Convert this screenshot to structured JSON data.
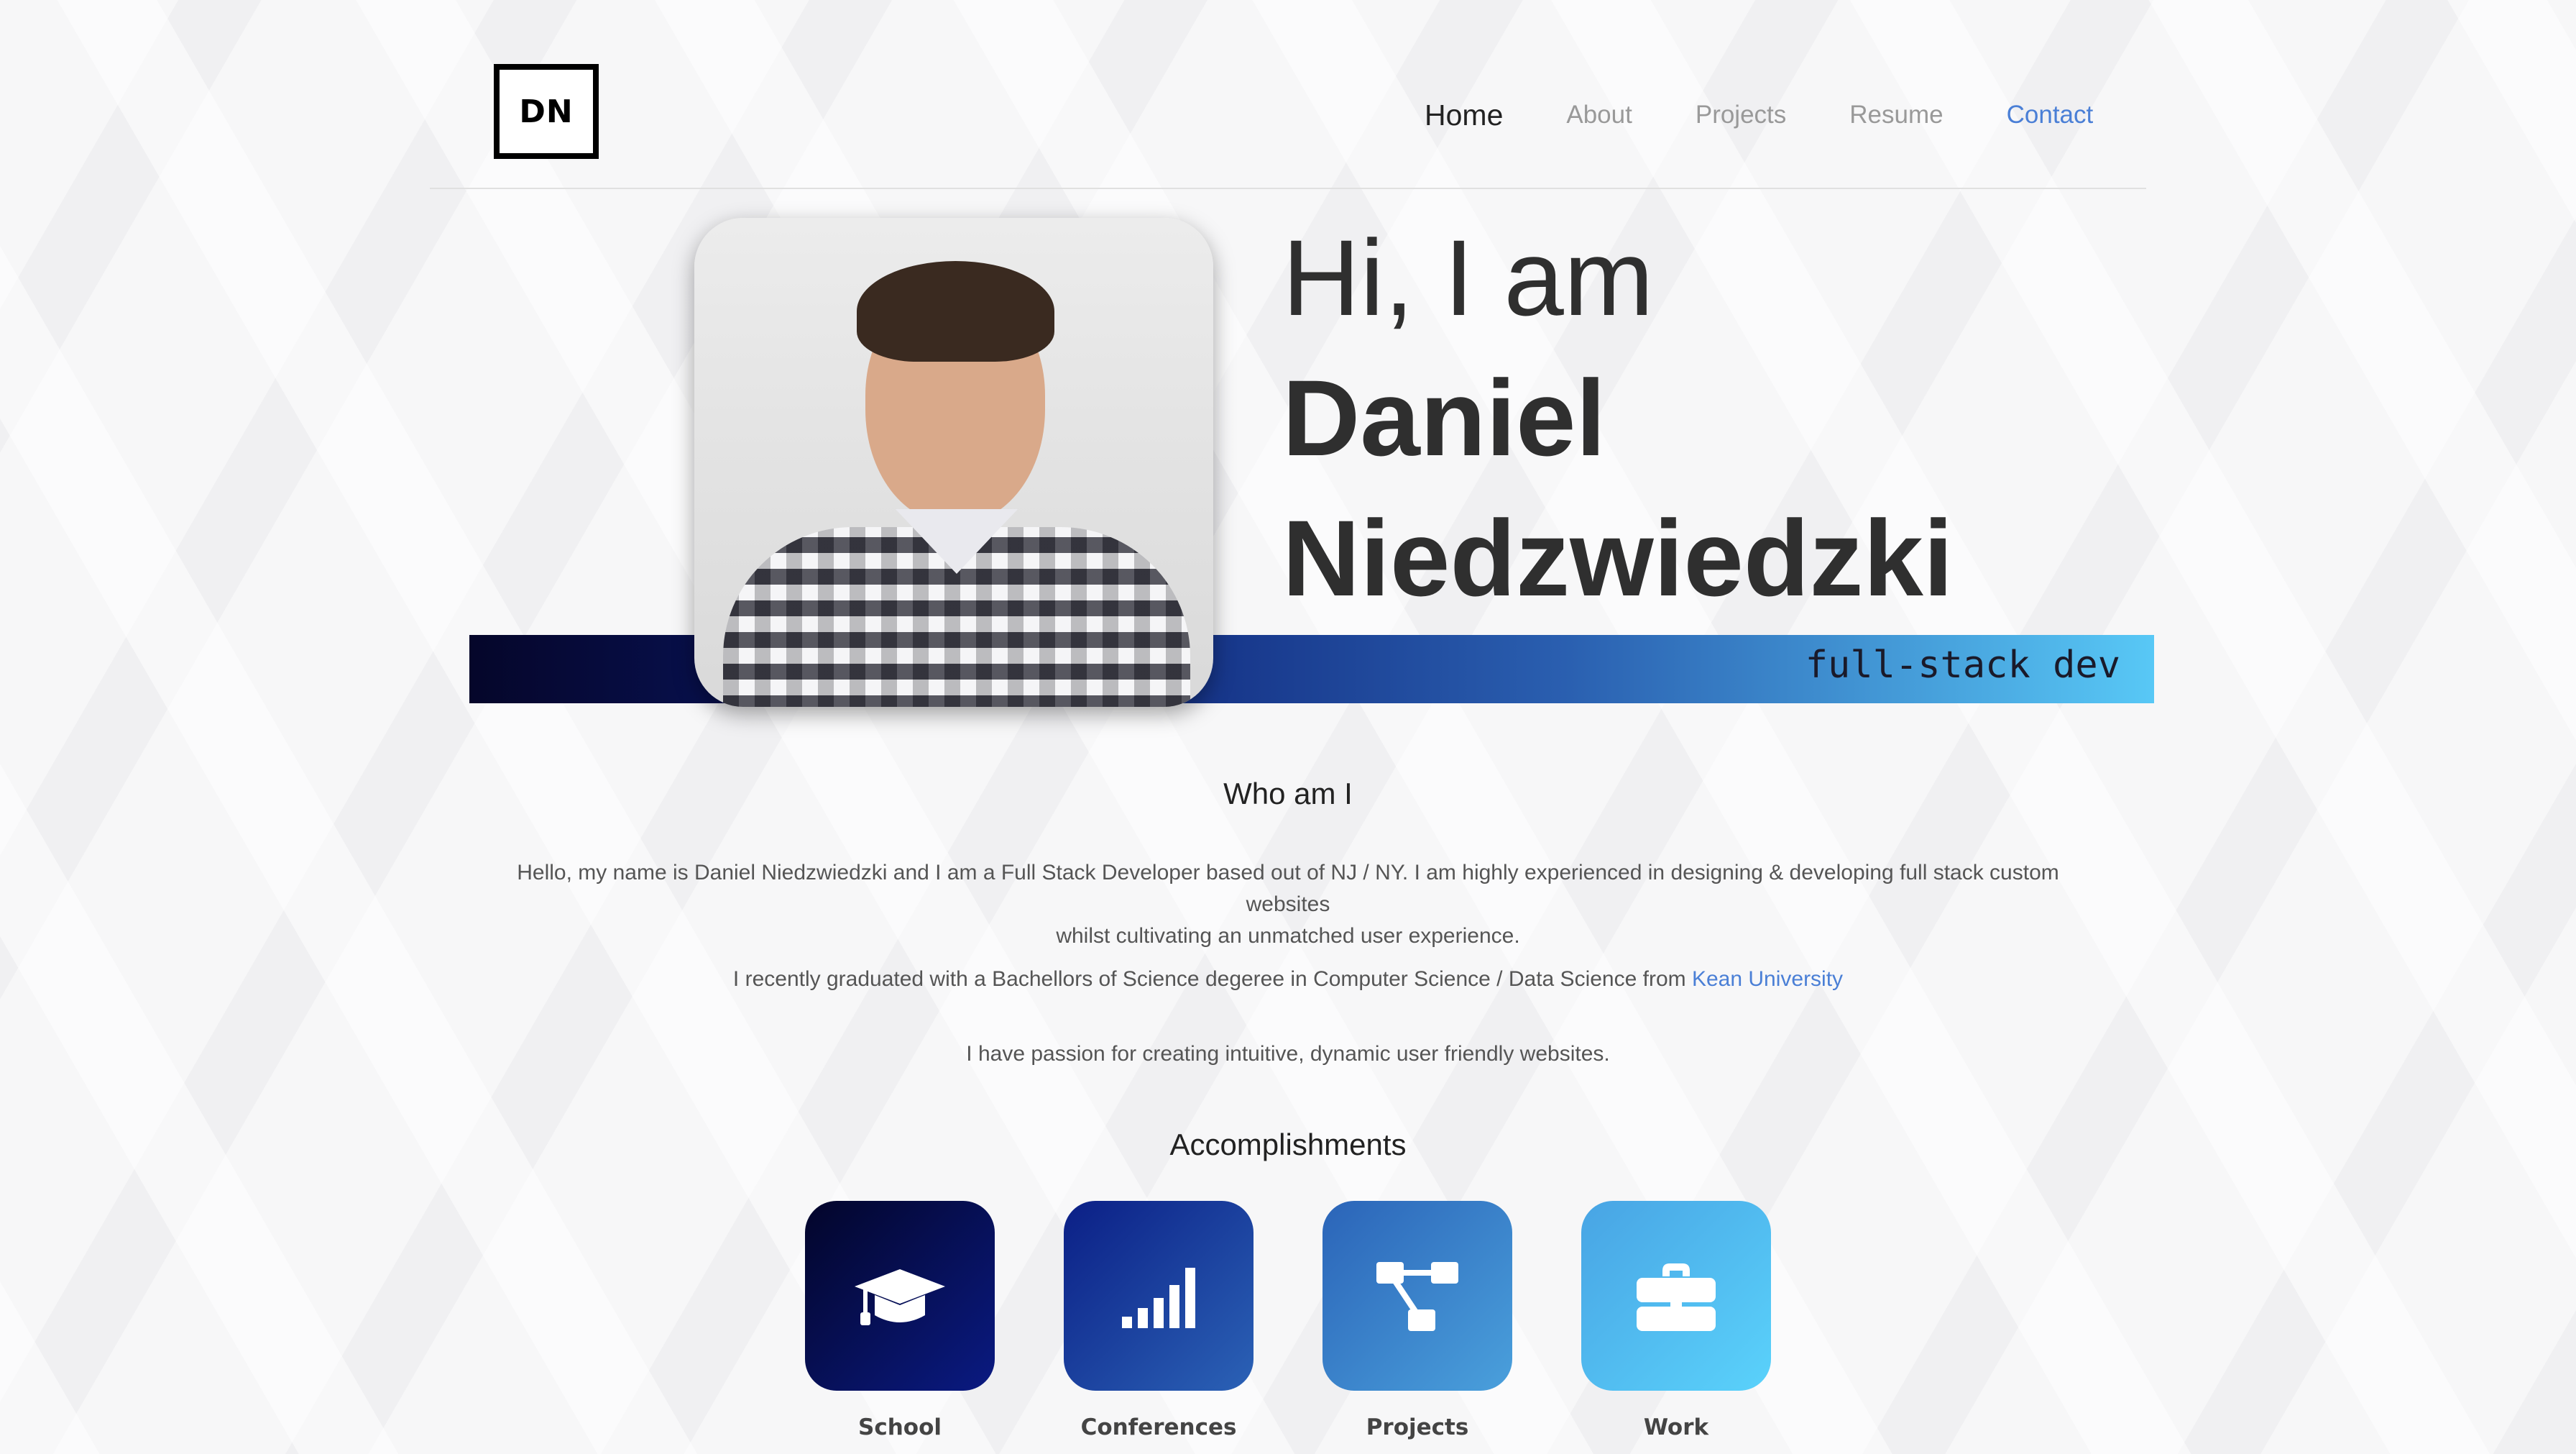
{
  "logo": {
    "text": "DN"
  },
  "nav": {
    "home": "Home",
    "about": "About",
    "projects": "Projects",
    "resume": "Resume",
    "contact": "Contact"
  },
  "hero": {
    "line1": "Hi, I am",
    "line2": "Daniel",
    "line3": "Niedzwiedzki",
    "role": "full-stack dev",
    "bar_gradient": [
      "#05062a",
      "#0a1a70",
      "#2a5fb0",
      "#58c8f6"
    ]
  },
  "about": {
    "title": "Who am I",
    "p1_line1": "Hello, my name is Daniel Niedzwiedzki and I am a Full Stack Developer based out of NJ / NY. I am highly experienced in designing & developing full stack custom websites",
    "p1_line2": "whilst cultivating an unmatched user experience.",
    "p2_text": "I recently graduated with a Bachellors of Science degeree in Computer Science / Data Science from ",
    "p2_link": "Kean University",
    "p3": "I have passion for creating intuitive, dynamic user friendly websites."
  },
  "accomplishments": {
    "title": "Accomplishments",
    "items": [
      {
        "label": "School",
        "icon": "graduation-cap-icon"
      },
      {
        "label": "Conferences",
        "icon": "signal-bars-icon"
      },
      {
        "label": "Projects",
        "icon": "project-diagram-icon"
      },
      {
        "label": "Work",
        "icon": "briefcase-icon"
      }
    ]
  },
  "colors": {
    "accent_link": "#4a7fd6",
    "text_dark": "#2f2f2f"
  }
}
